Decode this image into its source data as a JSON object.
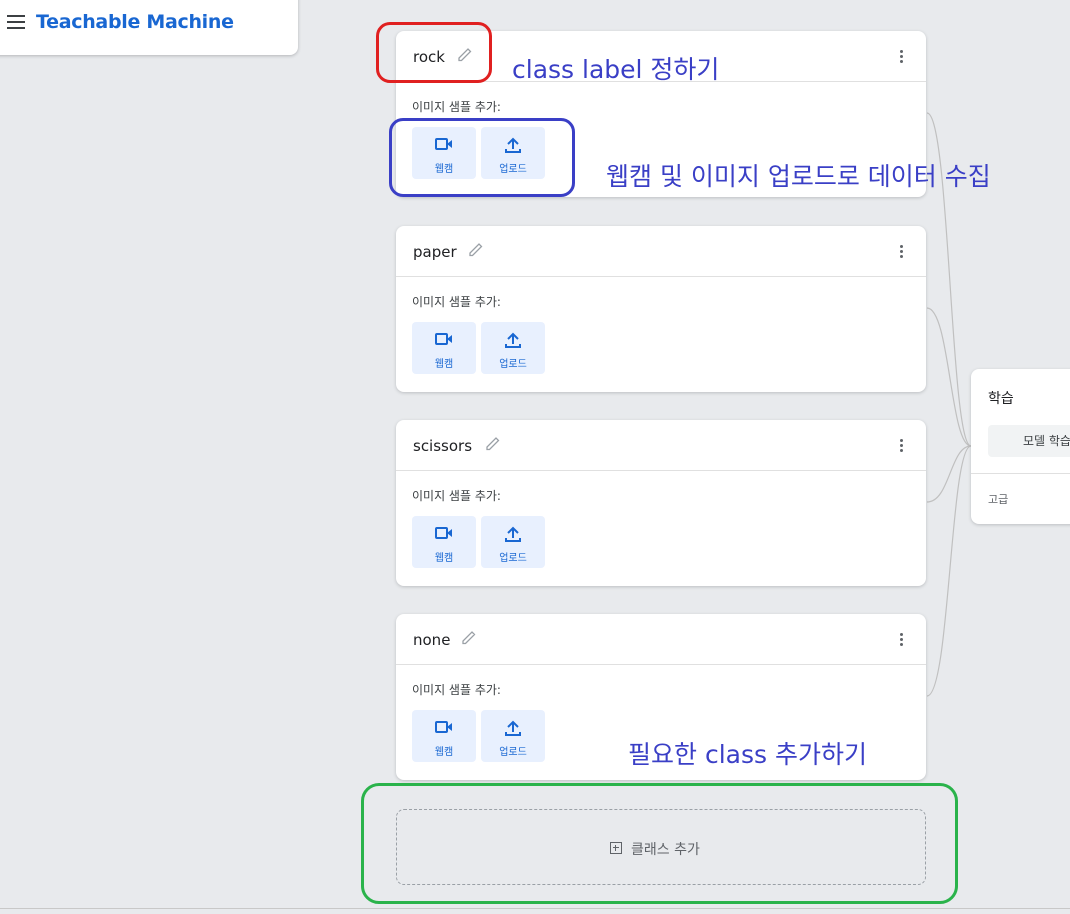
{
  "app": {
    "title": "Teachable Machine"
  },
  "classes": [
    {
      "name": "rock",
      "sample_label": "이미지 샘플 추가:",
      "webcam_label": "웹캠",
      "upload_label": "업로드"
    },
    {
      "name": "paper",
      "sample_label": "이미지 샘플 추가:",
      "webcam_label": "웹캠",
      "upload_label": "업로드"
    },
    {
      "name": "scissors",
      "sample_label": "이미지 샘플 추가:",
      "webcam_label": "웹캠",
      "upload_label": "업로드"
    },
    {
      "name": "none",
      "sample_label": "이미지 샘플 추가:",
      "webcam_label": "웹캠",
      "upload_label": "업로드"
    }
  ],
  "add_class": {
    "label": "클래스 추가"
  },
  "training": {
    "title": "학습",
    "button_label": "모델 학습시키기",
    "advanced_label": "고급"
  },
  "annotations": [
    {
      "text": "class label 정하기",
      "color": "#e02020"
    },
    {
      "text": "웹캠 및 이미지 업로드로 데이터 수집",
      "color": "#3a3fc6"
    },
    {
      "text": "필요한 class 추가하기",
      "color": "#2ab34b"
    }
  ],
  "icons": [
    "menu-icon",
    "pencil-icon",
    "more-vert-icon",
    "videocam-icon",
    "upload-icon",
    "add-box-icon"
  ],
  "colors": {
    "accent": "#1967d2",
    "button_bg": "#e8f0fe",
    "page_bg": "#e8eaed"
  }
}
